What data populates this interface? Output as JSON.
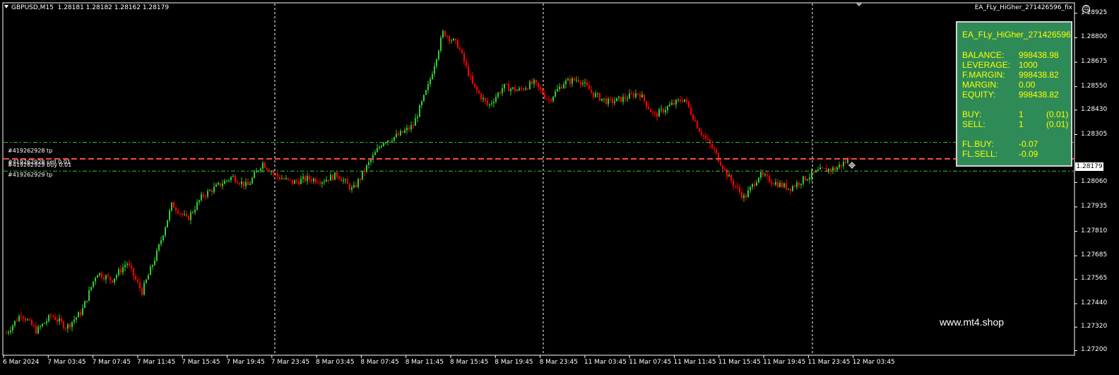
{
  "header": {
    "symbol_info": "GBPUSD,M15  1.28181 1.28182 1.28162 1.28179",
    "ea_name": "EA_FLy_HiGher_271426596_fix",
    "smile": "☺"
  },
  "panel": {
    "title": "EA_FLy_HiGher_271426596",
    "balance_label": "BALANCE:",
    "balance": "998438.98",
    "leverage_label": "LEVERAGE:",
    "leverage": "1000",
    "fmargin_label": "F.MARGIN:",
    "fmargin": "998438.82",
    "margin_label": "MARGIN:",
    "margin": "0.00",
    "equity_label": "EQUITY:",
    "equity": "998438.82",
    "buy_label": "BUY:",
    "buy_count": "1",
    "buy_lots": "(0.01)",
    "sell_label": "SELL:",
    "sell_count": "1",
    "sell_lots": "(0.01)",
    "flbuy_label": "FL.BUY:",
    "flbuy": "-0.07",
    "flsell_label": "FL.SELL:",
    "flsell": "-0.09"
  },
  "watermark": "www.mt4.shop",
  "tickets": {
    "tp_upper": "#419262928 tp",
    "sell_line": "#419262928 sell 0.01",
    "buy_line": "#419262929 buy 0.01",
    "tp_lower": "#419262929 tp"
  },
  "price_axis": {
    "current": "1.28179",
    "labels": [
      "1.28925",
      "1.28800",
      "1.28675",
      "1.28550",
      "1.28430",
      "1.28305",
      "1.28060",
      "1.27935",
      "1.27810",
      "1.27685",
      "1.27565",
      "1.27440",
      "1.27320",
      "1.27200"
    ]
  },
  "time_axis": {
    "labels": [
      "6 Mar 2024",
      "7 Mar 03:45",
      "7 Mar 07:45",
      "7 Mar 11:45",
      "7 Mar 15:45",
      "7 Mar 19:45",
      "7 Mar 23:45",
      "8 Mar 03:45",
      "8 Mar 07:45",
      "8 Mar 11:45",
      "8 Mar 15:45",
      "8 Mar 19:45",
      "8 Mar 23:45",
      "11 Mar 03:45",
      "11 Mar 07:45",
      "11 Mar 11:45",
      "11 Mar 15:45",
      "11 Mar 19:45",
      "11 Mar 23:45",
      "12 Mar 03:45"
    ]
  },
  "colors": {
    "bull": "#32cd32",
    "bear": "#ff0000",
    "tp_line": "#32cd32",
    "order_line": "#ff4d4d",
    "grid": "#ffffff",
    "panel_bg": "#2e8b57",
    "panel_text": "#ffff00"
  },
  "chart_data": {
    "type": "candlestick",
    "symbol": "GBPUSD",
    "timeframe": "M15",
    "ylim": [
      1.2718,
      1.28975
    ],
    "last": {
      "open": 1.28181,
      "high": 1.28182,
      "low": 1.28162,
      "close": 1.28179
    },
    "levels": {
      "tp_upper": 1.28265,
      "order": 1.28181,
      "tp_lower": 1.28118
    },
    "path": [
      1.2729,
      1.2739,
      1.273,
      1.2738,
      1.2732,
      1.274,
      1.276,
      1.2756,
      1.2765,
      1.275,
      1.277,
      1.2795,
      1.2787,
      1.2799,
      1.2804,
      1.2809,
      1.2804,
      1.2816,
      1.2809,
      1.2806,
      1.2808,
      1.2807,
      1.281,
      1.2802,
      1.2815,
      1.2827,
      1.283,
      1.2835,
      1.2855,
      1.2883,
      1.2876,
      1.2855,
      1.2845,
      1.2855,
      1.2853,
      1.2857,
      1.2848,
      1.2857,
      1.2859,
      1.2851,
      1.2847,
      1.2849,
      1.2852,
      1.284,
      1.2845,
      1.2849,
      1.2833,
      1.2822,
      1.2808,
      1.2798,
      1.281,
      1.2806,
      1.2803,
      1.2808,
      1.2812,
      1.2813,
      1.2818
    ]
  }
}
